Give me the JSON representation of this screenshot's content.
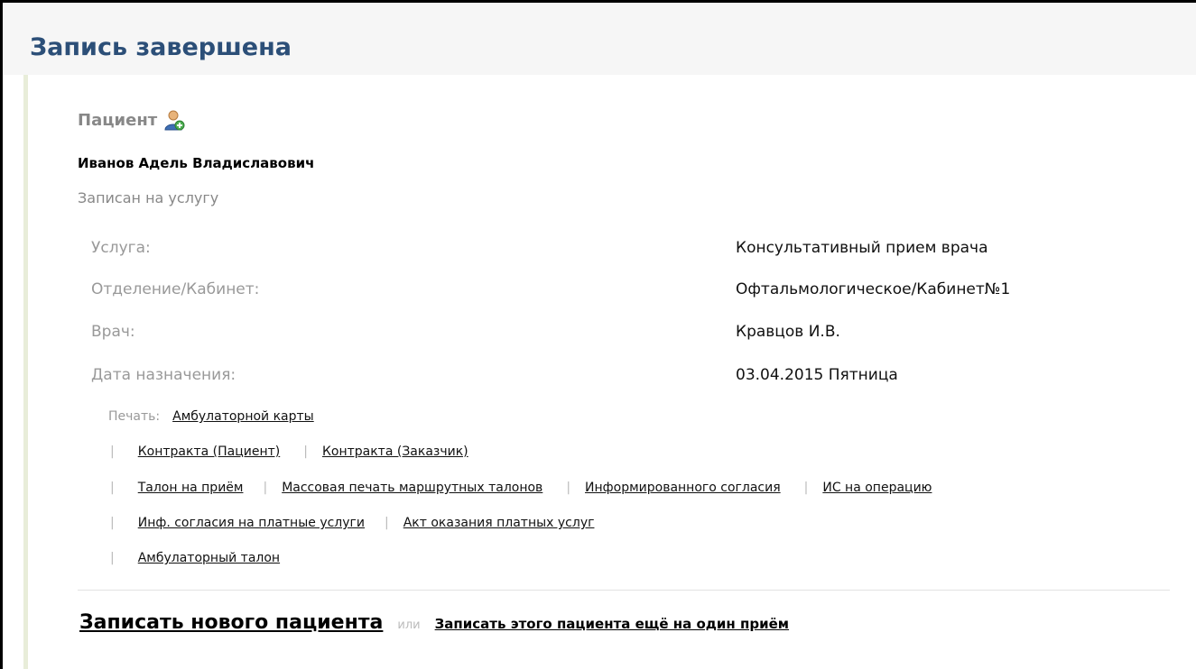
{
  "page": {
    "title": "Запись завершена"
  },
  "patient": {
    "section_label": "Пациент",
    "icon": "user-add-icon",
    "name": "Иванов Адель Владиславович",
    "subtitle": "Записан на услугу"
  },
  "details": [
    {
      "label": "Услуга:",
      "value": "Консультативный прием врача"
    },
    {
      "label": "Отделение/Кабинет:",
      "value": "Офтальмологическое/Кабинет№1"
    },
    {
      "label": "Врач:",
      "value": "Кравцов И.В."
    },
    {
      "label": "Дата назначения:",
      "value": "03.04.2015 Пятница"
    }
  ],
  "print": {
    "caption": "Печать:",
    "separator": "|",
    "links": [
      "Амбулаторной карты",
      "Контракта (Пациент)",
      "Контракта (Заказчик)",
      "Талон на приём",
      "Массовая печать маршрутных талонов",
      "Информированного согласия",
      "ИС на операцию",
      "Инф. согласия на платные услуги",
      "Акт оказания платных услуг",
      "Амбулаторный талон"
    ]
  },
  "actions": {
    "new_patient": "Записать нового пациента",
    "or": "или",
    "again": "Записать этого пациента ещё на один приём"
  },
  "colors": {
    "title": "#2c4f78",
    "accent_line": "#e8edd9",
    "muted_text": "#999999"
  }
}
